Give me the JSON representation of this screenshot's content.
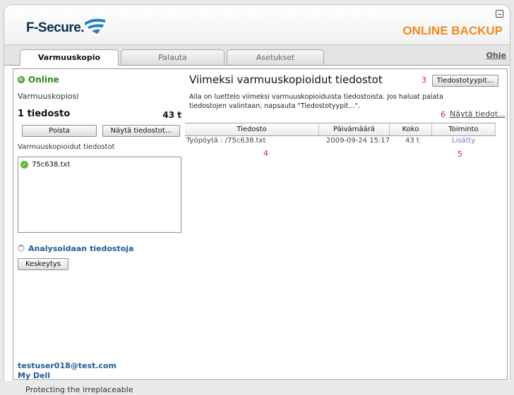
{
  "header": {
    "logo_text": "F-Secure.",
    "product": "ONLINE BACKUP"
  },
  "tabs": [
    {
      "label": "Varmuuskopio",
      "active": true
    },
    {
      "label": "Palauta",
      "active": false
    },
    {
      "label": "Asetukset",
      "active": false
    }
  ],
  "help_label": "Ohje",
  "left": {
    "status": "Online",
    "backups_label": "Varmuuskopiosi",
    "file_count": "1 tiedosto",
    "total_size": "43 t",
    "delete_button": "Poista",
    "show_files_button": "Näytä tiedostot...",
    "backed_up_files_label": "Varmuuskopioidut tiedostot",
    "files": [
      "75c638.txt"
    ],
    "analyzing": "Analysoidaan tiedostoja",
    "pause_button": "Keskeytys",
    "email": "testuser018@test.com",
    "my_dell": "My Dell"
  },
  "right": {
    "title": "Viimeksi varmuuskopioidut tiedostot",
    "filetypes_button": "Tiedostotyypit...",
    "description": "Alla on luettelo viimeksi varmuuskopioiduista tiedostoista. Jos haluat palata tiedostojen valintaan, napsauta \"Tiedostotyypit...\".",
    "show_files_link": "Näytä tiedot...",
    "columns": [
      "Tiedosto",
      "Päivämäärä",
      "Koko",
      "Toiminto"
    ],
    "rows": [
      {
        "file": "Työpöytä : /75c638.txt",
        "date": "2009-09-24 15:17",
        "size": "43 t",
        "action": "Lisätty"
      }
    ],
    "markers": {
      "m3": "3",
      "m4": "4",
      "m5": "5",
      "m6": "6"
    }
  },
  "footer": {
    "tagline": "Protecting the irreplaceable"
  },
  "colors": {
    "brand_orange": "#f08a1d",
    "brand_navy": "#0b2e52",
    "online_green": "#2d8a1a",
    "link_blue": "#1e5d96",
    "annotation_red": "#e02020"
  }
}
